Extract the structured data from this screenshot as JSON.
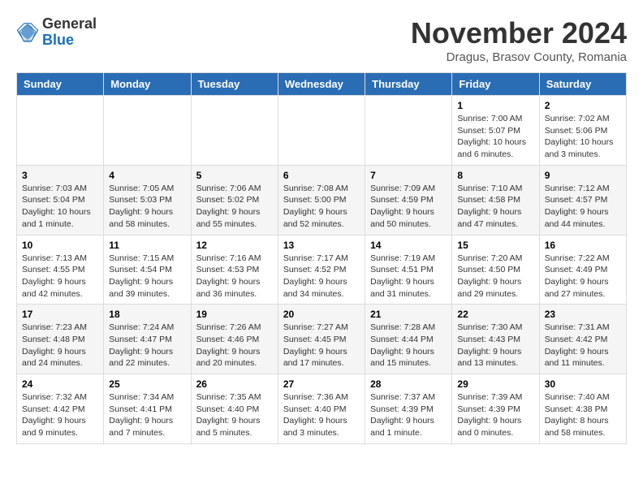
{
  "header": {
    "logo_line1": "General",
    "logo_line2": "Blue",
    "month_title": "November 2024",
    "location": "Dragus, Brasov County, Romania"
  },
  "weekdays": [
    "Sunday",
    "Monday",
    "Tuesday",
    "Wednesday",
    "Thursday",
    "Friday",
    "Saturday"
  ],
  "weeks": [
    [
      {
        "day": "",
        "info": ""
      },
      {
        "day": "",
        "info": ""
      },
      {
        "day": "",
        "info": ""
      },
      {
        "day": "",
        "info": ""
      },
      {
        "day": "",
        "info": ""
      },
      {
        "day": "1",
        "info": "Sunrise: 7:00 AM\nSunset: 5:07 PM\nDaylight: 10 hours\nand 6 minutes."
      },
      {
        "day": "2",
        "info": "Sunrise: 7:02 AM\nSunset: 5:06 PM\nDaylight: 10 hours\nand 3 minutes."
      }
    ],
    [
      {
        "day": "3",
        "info": "Sunrise: 7:03 AM\nSunset: 5:04 PM\nDaylight: 10 hours\nand 1 minute."
      },
      {
        "day": "4",
        "info": "Sunrise: 7:05 AM\nSunset: 5:03 PM\nDaylight: 9 hours\nand 58 minutes."
      },
      {
        "day": "5",
        "info": "Sunrise: 7:06 AM\nSunset: 5:02 PM\nDaylight: 9 hours\nand 55 minutes."
      },
      {
        "day": "6",
        "info": "Sunrise: 7:08 AM\nSunset: 5:00 PM\nDaylight: 9 hours\nand 52 minutes."
      },
      {
        "day": "7",
        "info": "Sunrise: 7:09 AM\nSunset: 4:59 PM\nDaylight: 9 hours\nand 50 minutes."
      },
      {
        "day": "8",
        "info": "Sunrise: 7:10 AM\nSunset: 4:58 PM\nDaylight: 9 hours\nand 47 minutes."
      },
      {
        "day": "9",
        "info": "Sunrise: 7:12 AM\nSunset: 4:57 PM\nDaylight: 9 hours\nand 44 minutes."
      }
    ],
    [
      {
        "day": "10",
        "info": "Sunrise: 7:13 AM\nSunset: 4:55 PM\nDaylight: 9 hours\nand 42 minutes."
      },
      {
        "day": "11",
        "info": "Sunrise: 7:15 AM\nSunset: 4:54 PM\nDaylight: 9 hours\nand 39 minutes."
      },
      {
        "day": "12",
        "info": "Sunrise: 7:16 AM\nSunset: 4:53 PM\nDaylight: 9 hours\nand 36 minutes."
      },
      {
        "day": "13",
        "info": "Sunrise: 7:17 AM\nSunset: 4:52 PM\nDaylight: 9 hours\nand 34 minutes."
      },
      {
        "day": "14",
        "info": "Sunrise: 7:19 AM\nSunset: 4:51 PM\nDaylight: 9 hours\nand 31 minutes."
      },
      {
        "day": "15",
        "info": "Sunrise: 7:20 AM\nSunset: 4:50 PM\nDaylight: 9 hours\nand 29 minutes."
      },
      {
        "day": "16",
        "info": "Sunrise: 7:22 AM\nSunset: 4:49 PM\nDaylight: 9 hours\nand 27 minutes."
      }
    ],
    [
      {
        "day": "17",
        "info": "Sunrise: 7:23 AM\nSunset: 4:48 PM\nDaylight: 9 hours\nand 24 minutes."
      },
      {
        "day": "18",
        "info": "Sunrise: 7:24 AM\nSunset: 4:47 PM\nDaylight: 9 hours\nand 22 minutes."
      },
      {
        "day": "19",
        "info": "Sunrise: 7:26 AM\nSunset: 4:46 PM\nDaylight: 9 hours\nand 20 minutes."
      },
      {
        "day": "20",
        "info": "Sunrise: 7:27 AM\nSunset: 4:45 PM\nDaylight: 9 hours\nand 17 minutes."
      },
      {
        "day": "21",
        "info": "Sunrise: 7:28 AM\nSunset: 4:44 PM\nDaylight: 9 hours\nand 15 minutes."
      },
      {
        "day": "22",
        "info": "Sunrise: 7:30 AM\nSunset: 4:43 PM\nDaylight: 9 hours\nand 13 minutes."
      },
      {
        "day": "23",
        "info": "Sunrise: 7:31 AM\nSunset: 4:42 PM\nDaylight: 9 hours\nand 11 minutes."
      }
    ],
    [
      {
        "day": "24",
        "info": "Sunrise: 7:32 AM\nSunset: 4:42 PM\nDaylight: 9 hours\nand 9 minutes."
      },
      {
        "day": "25",
        "info": "Sunrise: 7:34 AM\nSunset: 4:41 PM\nDaylight: 9 hours\nand 7 minutes."
      },
      {
        "day": "26",
        "info": "Sunrise: 7:35 AM\nSunset: 4:40 PM\nDaylight: 9 hours\nand 5 minutes."
      },
      {
        "day": "27",
        "info": "Sunrise: 7:36 AM\nSunset: 4:40 PM\nDaylight: 9 hours\nand 3 minutes."
      },
      {
        "day": "28",
        "info": "Sunrise: 7:37 AM\nSunset: 4:39 PM\nDaylight: 9 hours\nand 1 minute."
      },
      {
        "day": "29",
        "info": "Sunrise: 7:39 AM\nSunset: 4:39 PM\nDaylight: 9 hours\nand 0 minutes."
      },
      {
        "day": "30",
        "info": "Sunrise: 7:40 AM\nSunset: 4:38 PM\nDaylight: 8 hours\nand 58 minutes."
      }
    ]
  ]
}
